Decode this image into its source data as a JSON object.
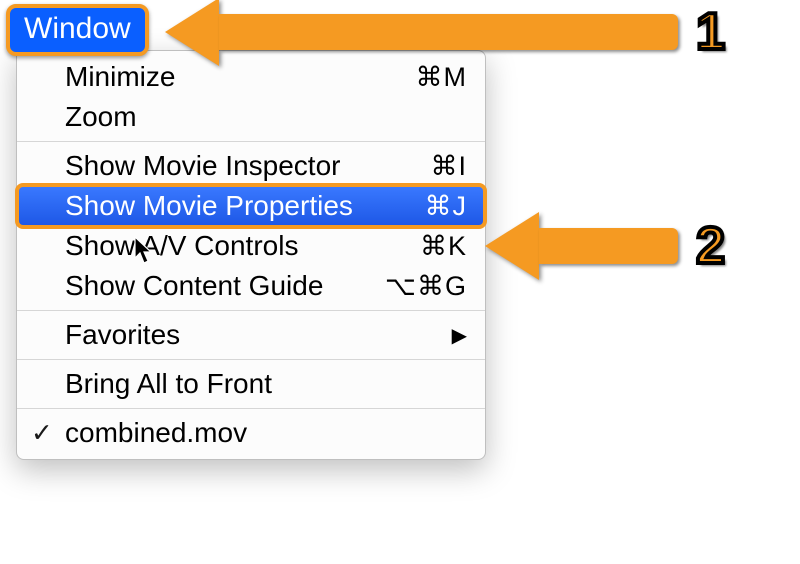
{
  "menuTitle": "Window",
  "groups": [
    [
      {
        "label": "Minimize",
        "shortcut": "⌘M",
        "highlight": false
      },
      {
        "label": "Zoom",
        "shortcut": "",
        "highlight": false
      }
    ],
    [
      {
        "label": "Show Movie Inspector",
        "shortcut": "⌘I",
        "highlight": false
      },
      {
        "label": "Show Movie Properties",
        "shortcut": "⌘J",
        "highlight": true
      },
      {
        "label": "Show A/V Controls",
        "shortcut": "⌘K",
        "highlight": false
      },
      {
        "label": "Show Content Guide",
        "shortcut": "⌥⌘G",
        "highlight": false
      }
    ],
    [
      {
        "label": "Favorites",
        "shortcut": "",
        "submenu": true
      }
    ],
    [
      {
        "label": "Bring All to Front",
        "shortcut": ""
      }
    ],
    [
      {
        "label": "combined.mov",
        "shortcut": "",
        "checked": true
      }
    ]
  ],
  "annotations": {
    "one": "1",
    "two": "2"
  }
}
